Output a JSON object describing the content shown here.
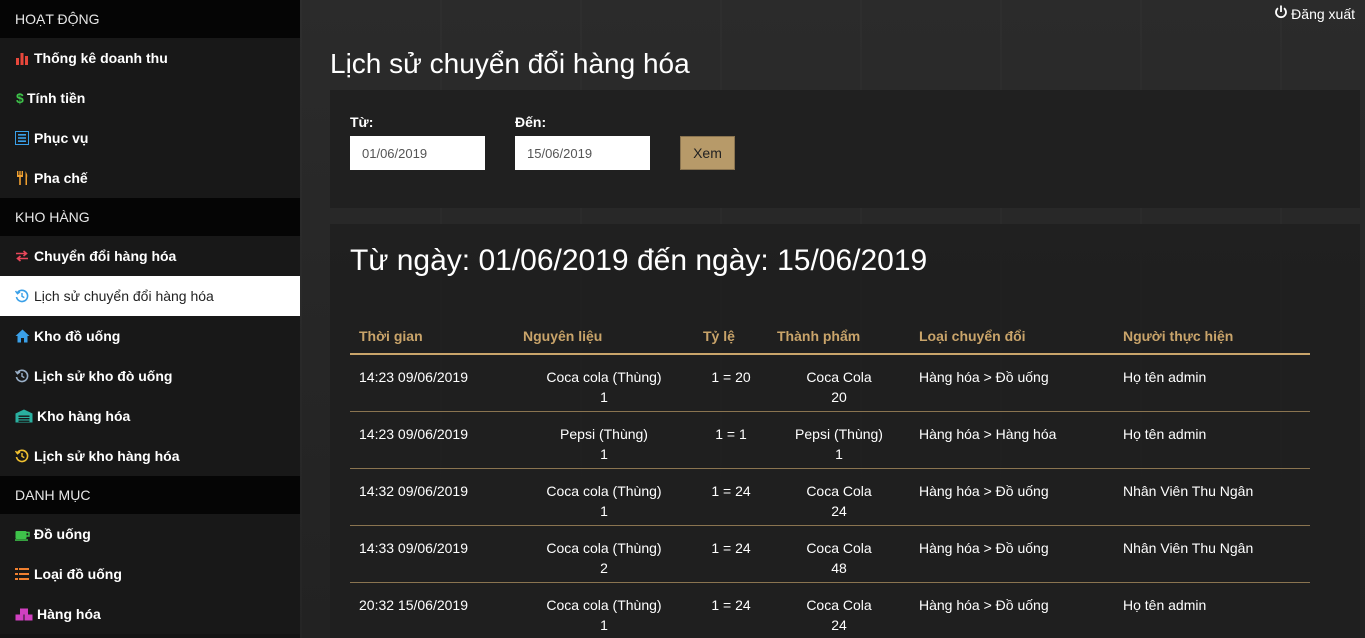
{
  "sidebar": {
    "section_activity": "HOẠT ĐỘNG",
    "section_warehouse": "KHO HÀNG",
    "section_catalog": "DANH MỤC",
    "items": [
      {
        "label": "Thống kê doanh thu",
        "icon": "bar-chart-icon",
        "color": "#e8473b"
      },
      {
        "label": "Tính tiền",
        "icon": "dollar-icon",
        "color": "#3ec34a"
      },
      {
        "label": "Phục vụ",
        "icon": "list-alt-icon",
        "color": "#3aa0e8"
      },
      {
        "label": "Pha chế",
        "icon": "cutlery-icon",
        "color": "#f0a030"
      },
      {
        "label": "Chuyển đổi hàng hóa",
        "icon": "exchange-icon",
        "color": "#e8475a"
      },
      {
        "label": "Lịch sử chuyển đổi hàng hóa",
        "icon": "history-icon",
        "color": "#3aa0e8"
      },
      {
        "label": "Kho đồ uống",
        "icon": "home-icon",
        "color": "#3aa0e8"
      },
      {
        "label": "Lịch sử kho đò uống",
        "icon": "history-icon",
        "color": "#9ab0c8"
      },
      {
        "label": "Kho hàng hóa",
        "icon": "warehouse-icon",
        "color": "#2ab0a0"
      },
      {
        "label": "Lịch sử kho hàng hóa",
        "icon": "history-icon",
        "color": "#f0c030"
      },
      {
        "label": "Đồ uống",
        "icon": "coffee-icon",
        "color": "#3ec34a"
      },
      {
        "label": "Loại đồ uống",
        "icon": "list-icon",
        "color": "#f08030"
      },
      {
        "label": "Hàng hóa",
        "icon": "cubes-icon",
        "color": "#d040c0"
      }
    ]
  },
  "header": {
    "logout_label": "Đăng xuất"
  },
  "page": {
    "title": "Lịch sử chuyển đổi hàng hóa"
  },
  "filter": {
    "from_label": "Từ:",
    "to_label": "Đến:",
    "from_value": "01/06/2019",
    "to_value": "15/06/2019",
    "view_button": "Xem"
  },
  "result": {
    "range_prefix": "Từ ngày: ",
    "range_from": "01/06/2019",
    "range_middle": " đến ngày: ",
    "range_to": "15/06/2019"
  },
  "table": {
    "headers": [
      "Thời gian",
      "Nguyên liệu",
      "Tỷ lệ",
      "Thành phẩm",
      "Loại chuyển đổi",
      "Người thực hiện"
    ],
    "rows": [
      {
        "time": "14:23 09/06/2019",
        "material": "Coca cola (Thùng)",
        "material_qty": "1",
        "ratio": "1 = 20",
        "product": "Coca Cola",
        "product_qty": "20",
        "type": "Hàng hóa > Đồ uống",
        "user": "Họ tên admin"
      },
      {
        "time": "14:23 09/06/2019",
        "material": "Pepsi (Thùng)",
        "material_qty": "1",
        "ratio": "1 = 1",
        "product": "Pepsi (Thùng)",
        "product_qty": "1",
        "type": "Hàng hóa > Hàng hóa",
        "user": "Họ tên admin"
      },
      {
        "time": "14:32 09/06/2019",
        "material": "Coca cola (Thùng)",
        "material_qty": "1",
        "ratio": "1 = 24",
        "product": "Coca Cola",
        "product_qty": "24",
        "type": "Hàng hóa > Đồ uống",
        "user": "Nhân Viên Thu Ngân"
      },
      {
        "time": "14:33 09/06/2019",
        "material": "Coca cola (Thùng)",
        "material_qty": "2",
        "ratio": "1 = 24",
        "product": "Coca Cola",
        "product_qty": "48",
        "type": "Hàng hóa > Đồ uống",
        "user": "Nhân Viên Thu Ngân"
      },
      {
        "time": "20:32 15/06/2019",
        "material": "Coca cola (Thùng)",
        "material_qty": "1",
        "ratio": "1 = 24",
        "product": "Coca Cola",
        "product_qty": "24",
        "type": "Hàng hóa > Đồ uống",
        "user": "Họ tên admin"
      }
    ]
  }
}
